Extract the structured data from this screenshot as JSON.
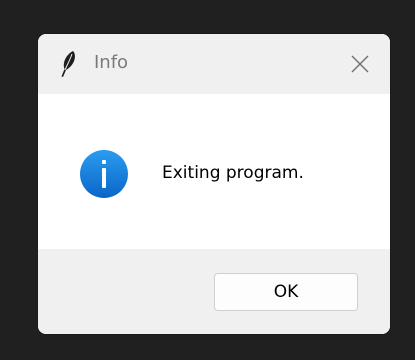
{
  "window": {
    "title": "Info",
    "app_icon": "feather-icon",
    "close_icon": "close-icon"
  },
  "body": {
    "icon": "info-icon",
    "message": "Exiting program."
  },
  "footer": {
    "ok_label": "OK"
  },
  "colors": {
    "accent": "#1a83d8",
    "titlebar_bg": "#f0f0f0",
    "content_bg": "#ffffff",
    "desktop_bg": "#202020"
  }
}
